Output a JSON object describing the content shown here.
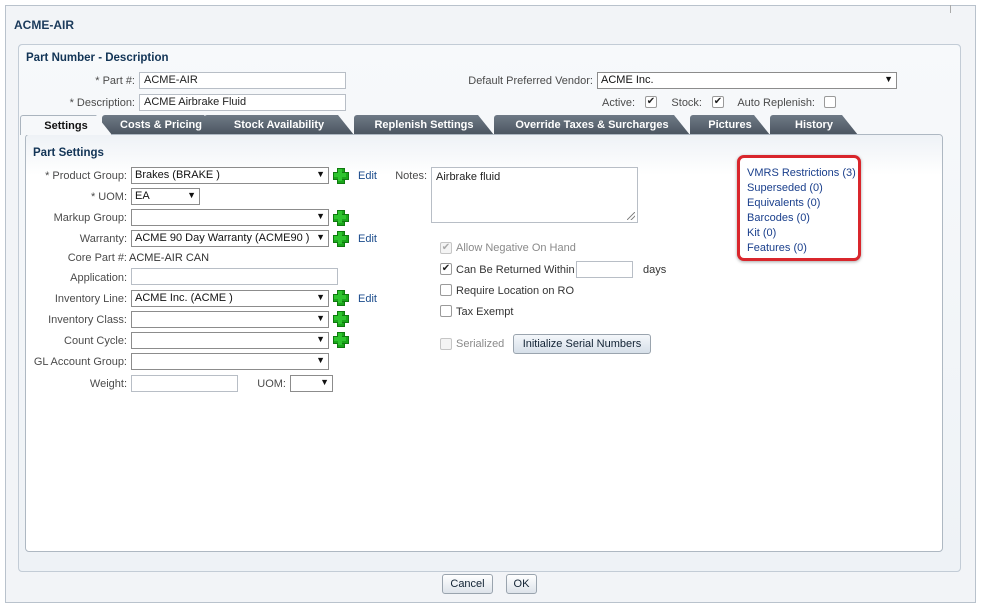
{
  "window": {
    "title": "ACME-AIR"
  },
  "part_section": {
    "title": "Part Number - Description",
    "part_label": "* Part #:",
    "part_value": "ACME-AIR",
    "desc_label": "* Description:",
    "desc_value": "ACME Airbrake Fluid",
    "vendor_label": "Default Preferred Vendor:",
    "vendor_value": "ACME Inc.",
    "active_label": "Active:",
    "active_checked": true,
    "stock_label": "Stock:",
    "stock_checked": true,
    "auto_replenish_label": "Auto Replenish:",
    "auto_replenish_checked": false
  },
  "tabs": [
    {
      "label": "Settings",
      "active": true
    },
    {
      "label": "Costs & Pricing"
    },
    {
      "label": "Stock Availability"
    },
    {
      "label": "Replenish Settings"
    },
    {
      "label": "Override Taxes & Surcharges"
    },
    {
      "label": "Pictures"
    },
    {
      "label": "History"
    }
  ],
  "settings": {
    "title": "Part Settings",
    "product_group_label": "* Product Group:",
    "product_group_value": "Brakes (BRAKE )",
    "uom_label": "* UOM:",
    "uom_value": "EA",
    "markup_group_label": "Markup Group:",
    "markup_group_value": "",
    "warranty_label": "Warranty:",
    "warranty_value": "ACME 90 Day Warranty (ACME90 )",
    "core_part_label": "Core Part #:",
    "core_part_value": "ACME-AIR CAN",
    "application_label": "Application:",
    "application_value": "",
    "inventory_line_label": "Inventory Line:",
    "inventory_line_value": "ACME Inc. (ACME )",
    "inventory_class_label": "Inventory Class:",
    "inventory_class_value": "",
    "count_cycle_label": "Count Cycle:",
    "count_cycle_value": "",
    "gl_account_label": "GL Account Group:",
    "gl_account_value": "",
    "weight_label": "Weight:",
    "weight_value": "",
    "weight_uom_label": "UOM:",
    "weight_uom_value": "",
    "edit_label": "Edit",
    "notes_label": "Notes:",
    "notes_value": "Airbrake fluid",
    "allow_negative_label": "Allow Negative On Hand",
    "allow_negative_checked": true,
    "can_be_returned_label": "Can Be Returned Within",
    "can_be_returned_checked": true,
    "days_value": "",
    "days_label": "days",
    "require_location_label": "Require Location on RO",
    "require_location_checked": false,
    "tax_exempt_label": "Tax Exempt",
    "tax_exempt_checked": false,
    "serialized_label": "Serialized",
    "serialized_checked": false,
    "init_serial_button": "Initialize Serial Numbers"
  },
  "side_links": {
    "vmrs": "VMRS Restrictions (3)",
    "superseded": "Superseded (0)",
    "equivalents": "Equivalents (0)",
    "barcodes": "Barcodes (0)",
    "kit": "Kit (0)",
    "features": "Features (0)"
  },
  "footer": {
    "cancel_label": "Cancel",
    "ok_label": "OK"
  },
  "colors": {
    "highlight_border": "#d9262c",
    "tab_dark": "#4a545f",
    "link": "#1a4b8c",
    "add_icon": "#1aa51a"
  }
}
